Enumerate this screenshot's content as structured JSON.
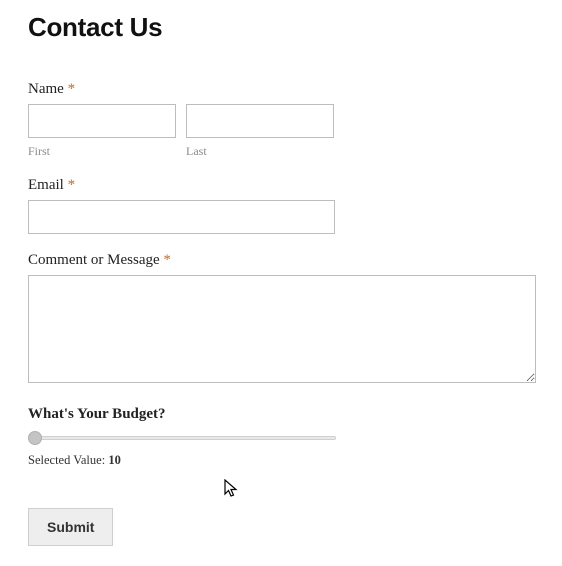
{
  "title": "Contact Us",
  "required_marker": "*",
  "name": {
    "label": "Name",
    "first_sublabel": "First",
    "last_sublabel": "Last",
    "first_value": "",
    "last_value": ""
  },
  "email": {
    "label": "Email",
    "value": ""
  },
  "message": {
    "label": "Comment or Message",
    "value": ""
  },
  "budget": {
    "label": "What's Your Budget?",
    "selected_label": "Selected Value: ",
    "selected_value": "10"
  },
  "submit_label": "Submit"
}
